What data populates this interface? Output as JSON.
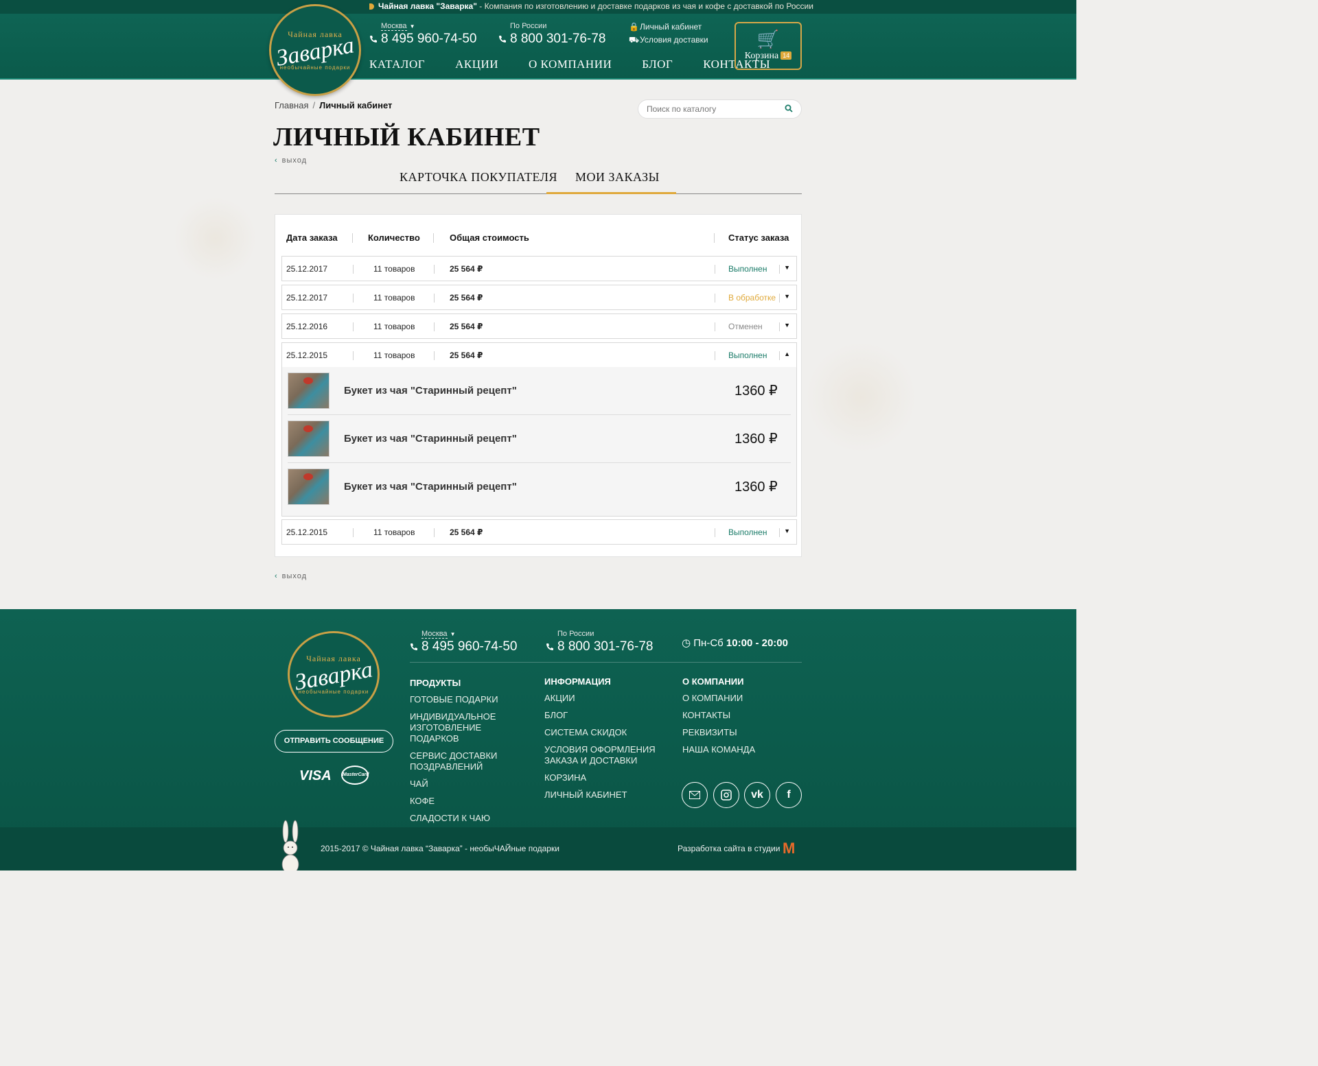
{
  "header": {
    "tagline_brand": "Чайная лавка \"Заварка\"",
    "tagline_text": " - Компания по изготовлению и доставке подарков из чая и кофе с доставкой по России",
    "logo": {
      "top": "Чайная лавка",
      "main": "Заварка",
      "sub": "необычайные подарки"
    },
    "phone_moscow": {
      "city": "Москва",
      "number": "8 495 960-74-50"
    },
    "phone_russia": {
      "city": "По России",
      "number": "8 800 301-76-78"
    },
    "account_link": "Личный кабинет",
    "delivery_link": "Условия доставки",
    "nav": [
      "Каталог",
      "Акции",
      "О компании",
      "Блог",
      "Контакты"
    ],
    "cart_label": "Корзина",
    "cart_count": "14"
  },
  "breadcrumb": {
    "home": "Главная",
    "sep": "/",
    "current": "Личный кабинет"
  },
  "search": {
    "placeholder": "Поиск по каталогу"
  },
  "page_title": "Личный кабинет",
  "logout_label": "выход",
  "tabs": {
    "customer_card": "Карточка покупателя",
    "my_orders": "Мои заказы"
  },
  "orders": {
    "columns": {
      "date": "Дата заказа",
      "quantity": "Количество",
      "total": "Общая стоимость",
      "status": "Статус заказа"
    },
    "rows": [
      {
        "date": "25.12.2017",
        "quantity": "11 товаров",
        "total": "25 564 ₽",
        "status": "Выполнен",
        "toggle": "▼"
      },
      {
        "date": "25.12.2017",
        "quantity": "11 товаров",
        "total": "25 564 ₽",
        "status": "В обработке",
        "toggle": "▼"
      },
      {
        "date": "25.12.2016",
        "quantity": "11 товаров",
        "total": "25 564 ₽",
        "status": "Отменен",
        "toggle": "▼"
      },
      {
        "date": "25.12.2015",
        "quantity": "11 товаров",
        "total": "25 564 ₽",
        "status": "Выполнен",
        "toggle": "▲"
      },
      {
        "date": "25.12.2015",
        "quantity": "11 товаров",
        "total": "25 564 ₽",
        "status": "Выполнен",
        "toggle": "▼"
      }
    ],
    "expanded_items": [
      {
        "name": "Букет из чая \"Старинный рецепт\"",
        "price": "1360 ₽"
      },
      {
        "name": "Букет из чая \"Старинный рецепт\"",
        "price": "1360 ₽"
      },
      {
        "name": "Букет из чая \"Старинный рецепт\"",
        "price": "1360 ₽"
      }
    ],
    "status_colors": {
      "done": "#1a7b68",
      "processing": "#e0a93a",
      "cancelled": "#888888"
    }
  },
  "footer": {
    "send_message": "Отправить сообщение",
    "payment": {
      "visa": "VISA",
      "mastercard": "MasterCard"
    },
    "phone_moscow": {
      "city": "Москва",
      "number": "8 495 960-74-50"
    },
    "phone_russia": {
      "city": "По России",
      "number": "8 800 301-76-78"
    },
    "hours_days": "Пн-Сб",
    "hours_time": "10:00 - 20:00",
    "products": {
      "title": "Продукты",
      "links": [
        "Готовые подарки",
        "Индивидуальное изготовление подарков",
        "Сервис доставки поздравлений",
        "Чай",
        "Кофе",
        "Сладости к чаю"
      ]
    },
    "info": {
      "title": "Информация",
      "links": [
        "Акции",
        "Блог",
        "Система скидок",
        "Условия оформления заказа и доставки",
        "Корзина",
        "Личный кабинет"
      ]
    },
    "company": {
      "title": "О компании",
      "links": [
        "О компании",
        "Контакты",
        "Реквизиты",
        "Наша команда"
      ]
    },
    "copyright": "2015-2017 © Чайная лавка “Заварка” - необыЧАЙные подарки",
    "studio": "Разработка сайта в студии"
  },
  "colors": {
    "brand_green": "#0f6656",
    "accent_gold": "#e0a93a"
  }
}
